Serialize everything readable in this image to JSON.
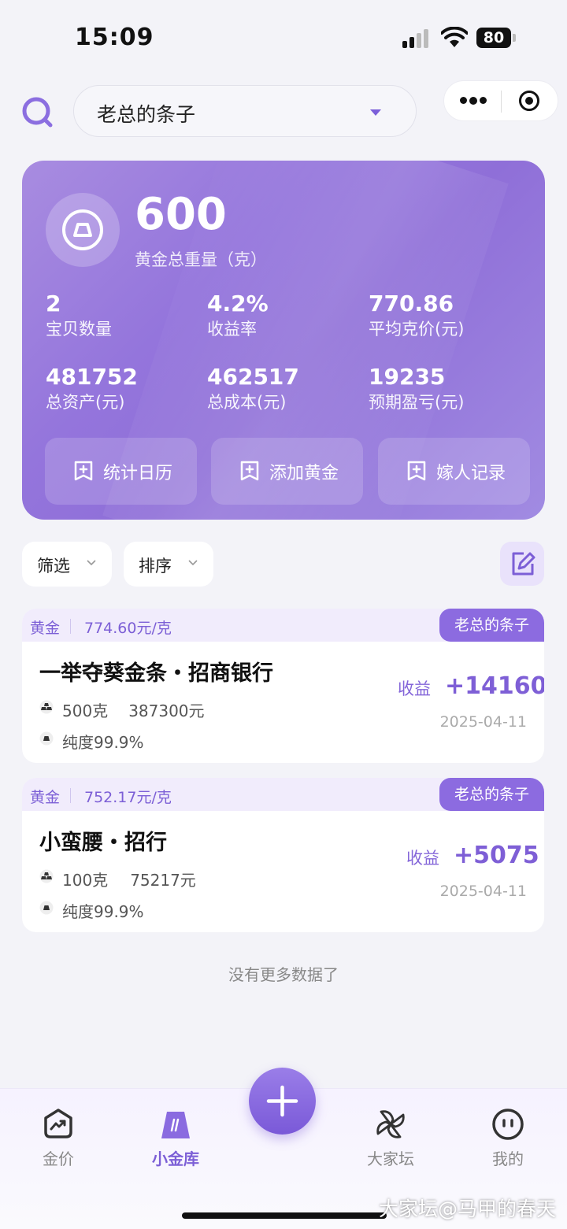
{
  "status_bar": {
    "time": "15:09",
    "battery": "80"
  },
  "header": {
    "store_name": "老总的条子"
  },
  "summary": {
    "total_weight": "600",
    "total_weight_label": "黄金总重量（克）",
    "stats": [
      {
        "value": "2",
        "label": "宝贝数量"
      },
      {
        "value": "4.2%",
        "label": "收益率"
      },
      {
        "value": "770.86",
        "label": "平均克价(元)"
      },
      {
        "value": "481752",
        "label": "总资产(元)"
      },
      {
        "value": "462517",
        "label": "总成本(元)"
      },
      {
        "value": "19235",
        "label": "预期盈亏(元)"
      }
    ],
    "actions": [
      "统计日历",
      "添加黄金",
      "嫁人记录"
    ]
  },
  "filters": {
    "filter_label": "筛选",
    "sort_label": "排序"
  },
  "items": [
    {
      "kind": "黄金",
      "unit_price": "774.60元/克",
      "store_tag": "老总的条子",
      "name": "一举夺葵金条・招商银行",
      "weight": "500克",
      "amount": "387300元",
      "purity": "纯度99.9%",
      "gain_label": "收益",
      "gain": "+14160",
      "date": "2025-04-11"
    },
    {
      "kind": "黄金",
      "unit_price": "752.17元/克",
      "store_tag": "老总的条子",
      "name": "小蛮腰・招行",
      "weight": "100克",
      "amount": "75217元",
      "purity": "纯度99.9%",
      "gain_label": "收益",
      "gain": "+5075",
      "date": "2025-04-11"
    }
  ],
  "no_more": "没有更多数据了",
  "tabs": [
    {
      "label": "金价",
      "icon": "chart-up-icon"
    },
    {
      "label": "小金库",
      "icon": "gold-bar-icon",
      "active": true
    },
    {
      "label": "大家坛",
      "icon": "pinwheel-icon"
    },
    {
      "label": "我的",
      "icon": "face-icon"
    }
  ],
  "watermark": "大家坛@马甲的春天",
  "colors": {
    "accent": "#8c6be0",
    "summary_card": "#9475dc",
    "background": "#f3f3f8"
  }
}
